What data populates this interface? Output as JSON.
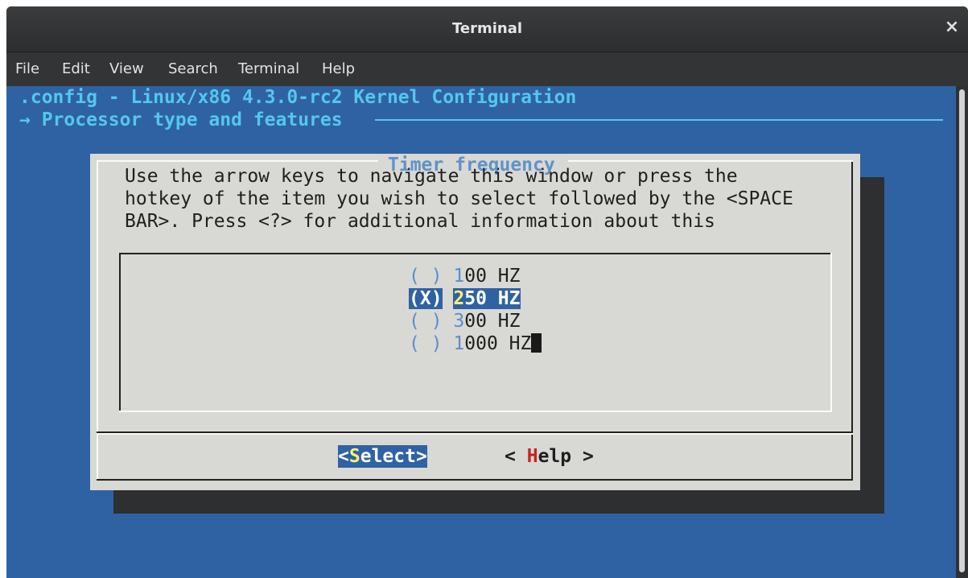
{
  "window": {
    "title": "Terminal",
    "close_icon": "×"
  },
  "menu": [
    "File",
    "Edit",
    "View",
    "Search",
    "Terminal",
    "Help"
  ],
  "terminal": {
    "header_line1": ".config - Linux/x86 4.3.0-rc2 Kernel Configuration",
    "header_arrow": "→",
    "header_section": "Processor type and features"
  },
  "dialog": {
    "title": "Timer frequency",
    "help_lines": [
      "Use the arrow keys to navigate this window or press the",
      "hotkey of the item you wish to select followed by the <SPACE",
      "BAR>. Press <?> for additional information about this"
    ],
    "options": [
      {
        "mark": "( )",
        "hotkey": "1",
        "rest": "00 HZ",
        "selected": false
      },
      {
        "mark": "(X)",
        "hotkey": "2",
        "rest": "50 HZ",
        "selected": true
      },
      {
        "mark": "( )",
        "hotkey": "3",
        "rest": "00 HZ",
        "selected": false
      },
      {
        "mark": "( )",
        "hotkey": "1",
        "rest": "000 HZ",
        "selected": false
      }
    ],
    "buttons": {
      "select": {
        "open": "<",
        "hotkey": "S",
        "rest": "elect>"
      },
      "help": {
        "open": "< ",
        "hotkey": "H",
        "rest": "elp >"
      }
    }
  },
  "colors": {
    "terminal_bg": "#2f62a3",
    "header_fg": "#54c7ec",
    "dialog_bg": "#d8d8d4",
    "hotkey_yellow": "#ffef73",
    "hotkey_red": "#c42323"
  }
}
